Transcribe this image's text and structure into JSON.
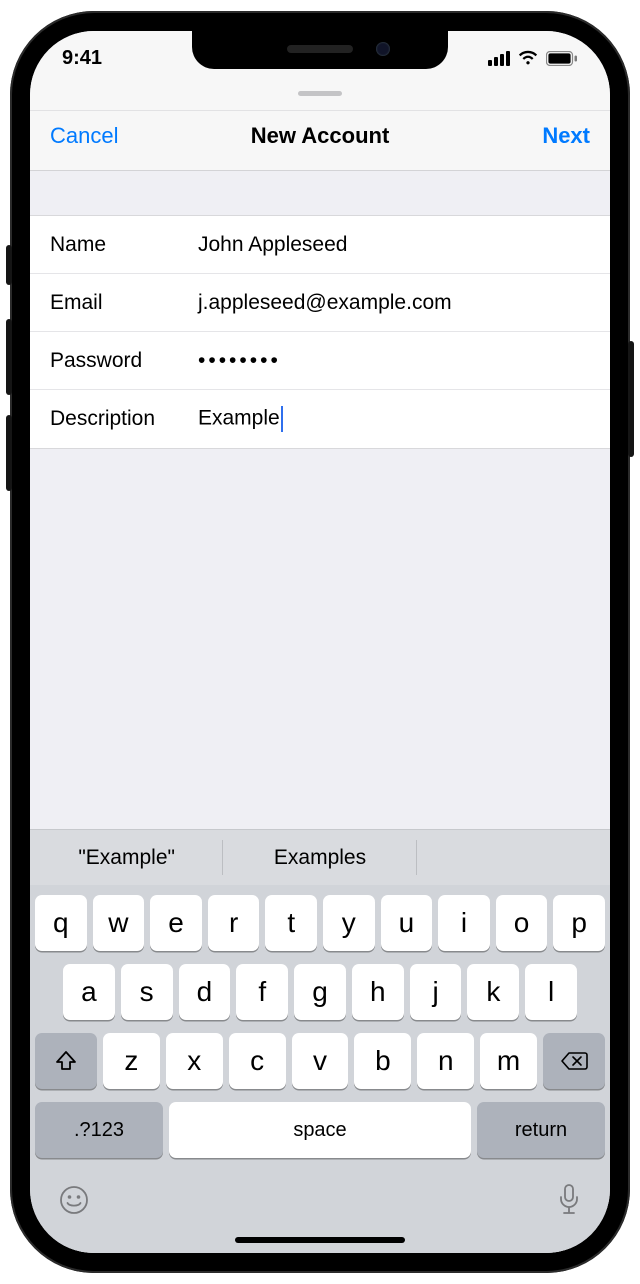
{
  "status": {
    "time": "9:41"
  },
  "nav": {
    "left": "Cancel",
    "title": "New Account",
    "right": "Next"
  },
  "form": {
    "name_label": "Name",
    "name_value": "John Appleseed",
    "email_label": "Email",
    "email_value": "j.appleseed@example.com",
    "password_label": "Password",
    "password_value": "••••••••",
    "description_label": "Description",
    "description_value": "Example"
  },
  "suggestions": [
    "\"Example\"",
    "Examples",
    ""
  ],
  "keyboard": {
    "row1": [
      "q",
      "w",
      "e",
      "r",
      "t",
      "y",
      "u",
      "i",
      "o",
      "p"
    ],
    "row2": [
      "a",
      "s",
      "d",
      "f",
      "g",
      "h",
      "j",
      "k",
      "l"
    ],
    "row3": [
      "z",
      "x",
      "c",
      "v",
      "b",
      "n",
      "m"
    ],
    "numbers_key": ".?123",
    "space_key": "space",
    "return_key": "return"
  },
  "colors": {
    "accent": "#007aff"
  }
}
